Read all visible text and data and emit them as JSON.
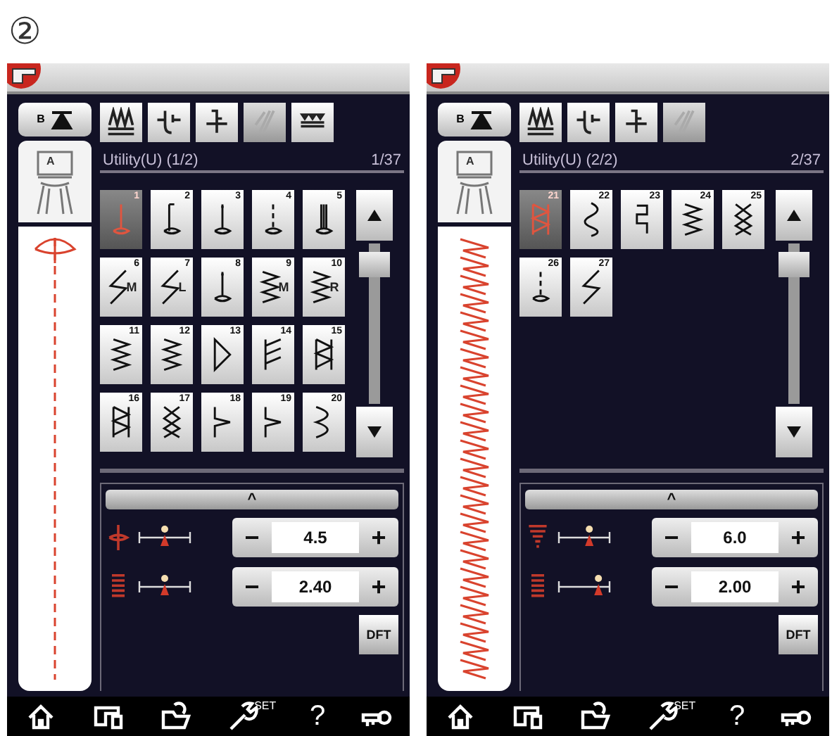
{
  "header": {
    "number": "②"
  },
  "panels": [
    {
      "foot_button": {
        "letter": "B"
      },
      "foot_label": "A",
      "preview": {
        "kind": "straight"
      },
      "toolbar": [
        {
          "kind": "feed",
          "disabled": false
        },
        {
          "kind": "shift",
          "disabled": false
        },
        {
          "kind": "pressure",
          "disabled": false
        },
        {
          "kind": "needle",
          "disabled": true
        },
        {
          "kind": "triple",
          "disabled": false
        }
      ],
      "category": "Utility(U) (1/2)",
      "counter": "1/37",
      "stitches": [
        {
          "number": "1",
          "kind": "straight",
          "selected": true
        },
        {
          "number": "2",
          "kind": "lock",
          "selected": false
        },
        {
          "number": "3",
          "kind": "dot",
          "selected": false
        },
        {
          "number": "4",
          "kind": "dashed",
          "selected": false
        },
        {
          "number": "5",
          "kind": "triple",
          "selected": false
        },
        {
          "number": "6",
          "letter": "M",
          "kind": "bolt",
          "selected": false
        },
        {
          "number": "7",
          "letter": "L",
          "kind": "bolt",
          "selected": false
        },
        {
          "number": "8",
          "kind": "dot",
          "selected": false
        },
        {
          "number": "9",
          "letter": "M",
          "kind": "zigzag",
          "selected": false
        },
        {
          "number": "10",
          "letter": "R",
          "kind": "zigzag",
          "selected": false
        },
        {
          "number": "11",
          "kind": "zigzag",
          "selected": false
        },
        {
          "number": "12",
          "kind": "zigzag",
          "selected": false
        },
        {
          "number": "13",
          "kind": "triangle",
          "selected": false
        },
        {
          "number": "14",
          "kind": "feather",
          "selected": false
        },
        {
          "number": "15",
          "kind": "overlock",
          "selected": false
        },
        {
          "number": "16",
          "kind": "overlock",
          "selected": false
        },
        {
          "number": "17",
          "kind": "cross",
          "selected": false
        },
        {
          "number": "18",
          "kind": "blind",
          "selected": false
        },
        {
          "number": "19",
          "kind": "blind",
          "selected": false
        },
        {
          "number": "20",
          "kind": "scallop",
          "selected": false
        }
      ],
      "collapse": "^",
      "settings": [
        {
          "kind": "width",
          "level": 0.5,
          "minus": "−",
          "value": "4.5",
          "plus": "+"
        },
        {
          "kind": "length",
          "level": 0.5,
          "minus": "−",
          "value": "2.40",
          "plus": "+"
        }
      ],
      "default_button": "DFT",
      "nav": [
        {
          "kind": "home"
        },
        {
          "kind": "machine"
        },
        {
          "kind": "folder"
        },
        {
          "kind": "settings",
          "label": "SET"
        },
        {
          "kind": "help",
          "label": "?"
        },
        {
          "kind": "key"
        }
      ]
    },
    {
      "foot_button": {
        "letter": "B"
      },
      "foot_label": "A",
      "preview": {
        "kind": "chain"
      },
      "toolbar": [
        {
          "kind": "feed",
          "disabled": false
        },
        {
          "kind": "shift",
          "disabled": false
        },
        {
          "kind": "pressure",
          "disabled": false
        },
        {
          "kind": "needle",
          "disabled": true
        }
      ],
      "category": "Utility(U) (2/2)",
      "counter": "2/37",
      "stitches": [
        {
          "number": "21",
          "kind": "overlock",
          "selected": true
        },
        {
          "number": "22",
          "kind": "wave",
          "selected": false
        },
        {
          "number": "23",
          "kind": "square",
          "selected": false
        },
        {
          "number": "24",
          "kind": "zigzag",
          "selected": false
        },
        {
          "number": "25",
          "kind": "cross",
          "selected": false
        },
        {
          "number": "26",
          "kind": "dashed",
          "selected": false
        },
        {
          "number": "27",
          "kind": "bolt",
          "selected": false
        }
      ],
      "collapse": "^",
      "settings": [
        {
          "kind": "taper",
          "level": 0.6,
          "minus": "−",
          "value": "6.0",
          "plus": "+"
        },
        {
          "kind": "length",
          "level": 0.78,
          "minus": "−",
          "value": "2.00",
          "plus": "+"
        }
      ],
      "default_button": "DFT",
      "nav": [
        {
          "kind": "home"
        },
        {
          "kind": "machine"
        },
        {
          "kind": "folder"
        },
        {
          "kind": "settings",
          "label": "SET"
        },
        {
          "kind": "help",
          "label": "?"
        },
        {
          "kind": "key"
        }
      ]
    }
  ]
}
